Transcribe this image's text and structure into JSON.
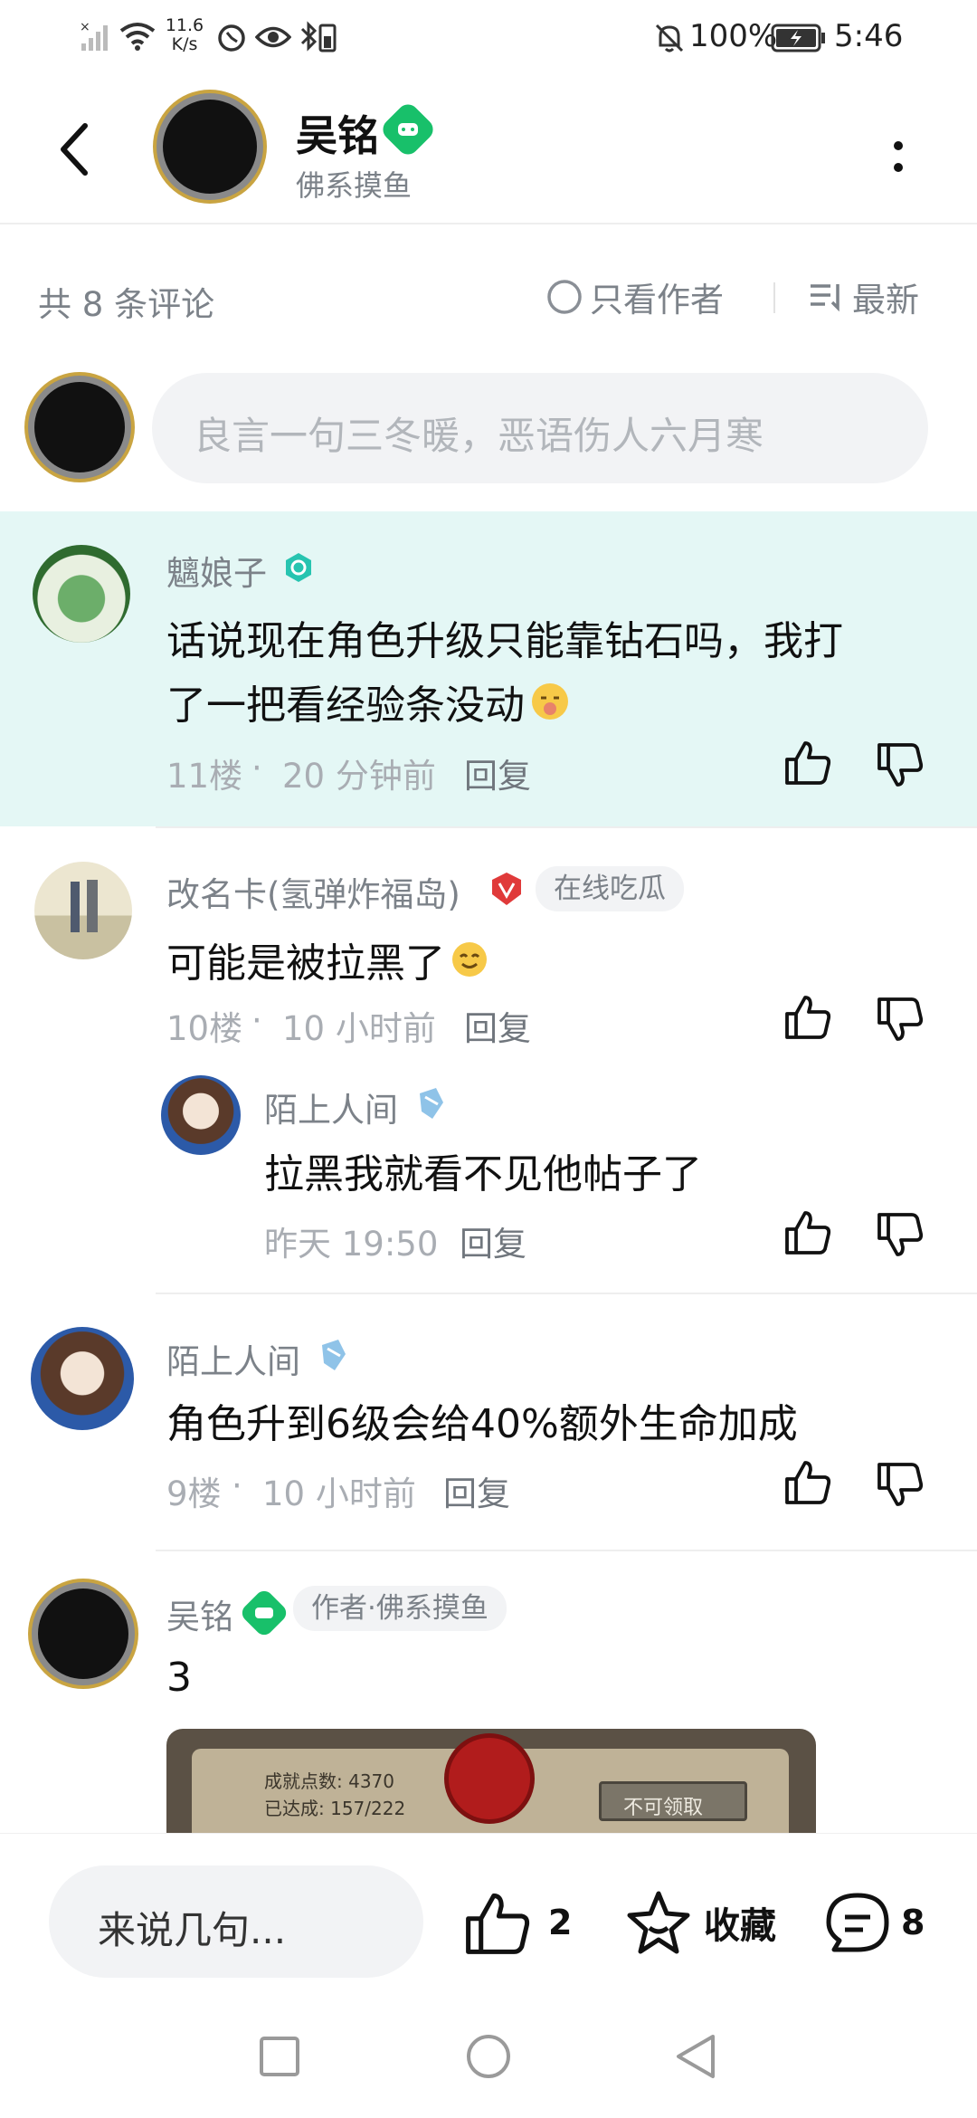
{
  "status_bar": {
    "net_speed_value": "11.6",
    "net_speed_unit": "K/s",
    "battery": "100%",
    "time": "5:46"
  },
  "header": {
    "author_name": "吴铭",
    "author_subtitle": "佛系摸鱼"
  },
  "comments_header": {
    "count_label": "共 8 条评论",
    "author_only_label": "只看作者",
    "sort_label": "最新"
  },
  "composer": {
    "placeholder": "良言一句三冬暖，恶语伤人六月寒"
  },
  "comments": [
    {
      "name": "魑娘子",
      "text_line1": "话说现在角色升级只能靠钻石吗，我打",
      "text_line2": "了一把看经验条没动",
      "floor": "11楼",
      "time": "20 分钟前",
      "reply_label": "回复",
      "highlight_color": "#e4f7f5"
    },
    {
      "name": "改名卡(氢弹炸福岛)",
      "tag": "在线吃瓜",
      "text": "可能是被拉黑了",
      "floor": "10楼",
      "time": "10 小时前",
      "reply_label": "回复",
      "sub_reply": {
        "name": "陌上人间",
        "text": "拉黑我就看不见他帖子了",
        "time": "昨天 19:50",
        "reply_label": "回复"
      }
    },
    {
      "name": "陌上人间",
      "text": "角色升到6级会给40%额外生命加成",
      "floor": "9楼",
      "time": "10 小时前",
      "reply_label": "回复"
    },
    {
      "name": "吴铭",
      "tag": "作者·佛系摸鱼",
      "text": "3",
      "image": {
        "points_label": "成就点数: 4370",
        "achieved_label": "已达成: 157/222",
        "button_label": "不可领取"
      }
    }
  ],
  "bottom_bar": {
    "input_placeholder": "来说几句...",
    "like_count": "2",
    "favorite_label": "收藏",
    "comment_count": "8"
  },
  "colors": {
    "brand_green": "#18c06a",
    "highlight_bg": "#e4f7f5",
    "meta_gray": "#a9adb3"
  }
}
